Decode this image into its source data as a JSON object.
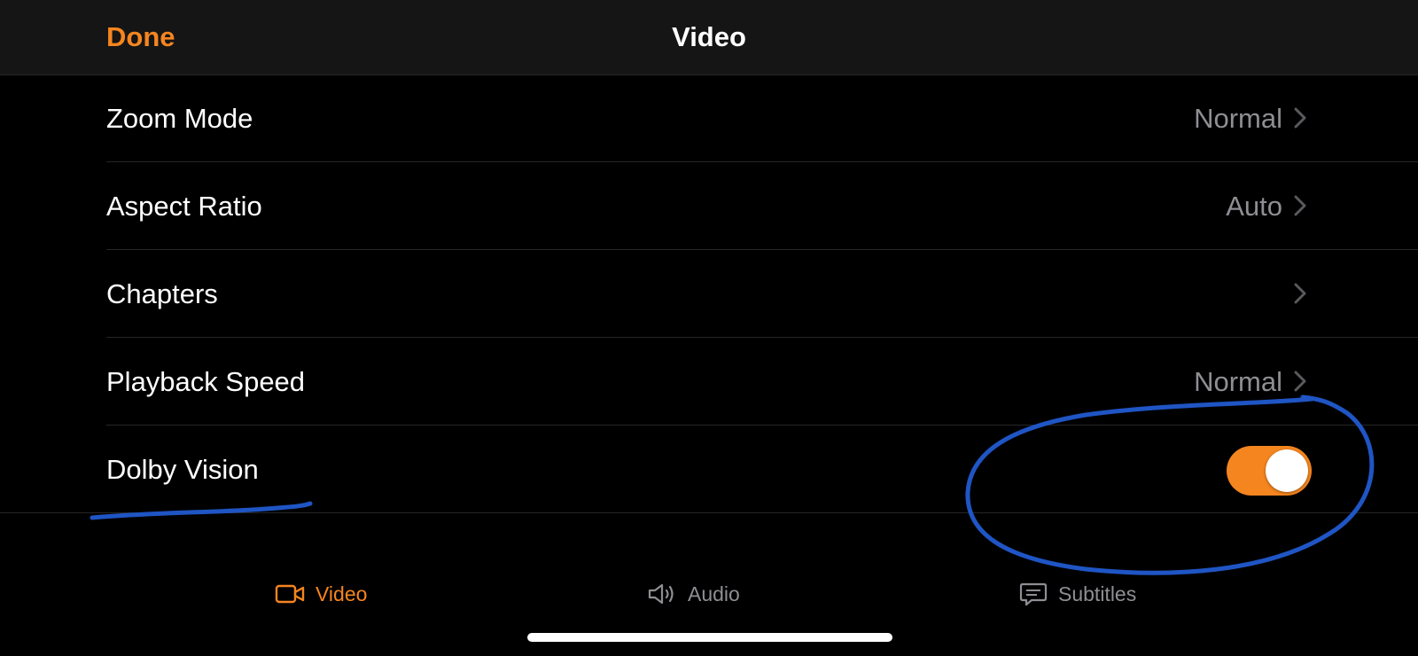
{
  "nav": {
    "done_label": "Done",
    "title": "Video"
  },
  "settings": {
    "rows": [
      {
        "label": "Zoom Mode",
        "value": "Normal",
        "control": "chevron"
      },
      {
        "label": "Aspect Ratio",
        "value": "Auto",
        "control": "chevron"
      },
      {
        "label": "Chapters",
        "value": "",
        "control": "chevron"
      },
      {
        "label": "Playback Speed",
        "value": "Normal",
        "control": "chevron"
      },
      {
        "label": "Dolby Vision",
        "value": "",
        "control": "toggle",
        "toggle_on": true
      }
    ]
  },
  "tabs": [
    {
      "label": "Video",
      "icon": "video-camera-icon",
      "selected": true
    },
    {
      "label": "Audio",
      "icon": "speaker-icon",
      "selected": false
    },
    {
      "label": "Subtitles",
      "icon": "speech-bubble-icon",
      "selected": false
    }
  ],
  "colors": {
    "accent": "#f5851f",
    "background": "#000000",
    "nav_background": "#151515",
    "secondary_text": "#8e8e93",
    "annotation_ink": "#1f55c4"
  }
}
